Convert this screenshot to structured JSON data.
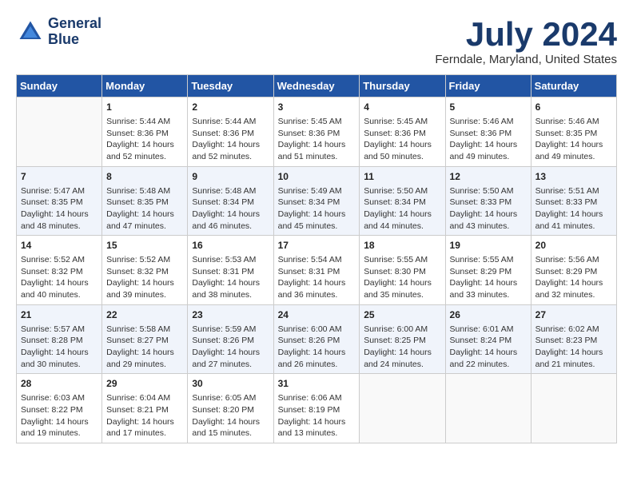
{
  "logo": {
    "line1": "General",
    "line2": "Blue"
  },
  "title": "July 2024",
  "location": "Ferndale, Maryland, United States",
  "days_of_week": [
    "Sunday",
    "Monday",
    "Tuesday",
    "Wednesday",
    "Thursday",
    "Friday",
    "Saturday"
  ],
  "weeks": [
    [
      {
        "day": "",
        "info": ""
      },
      {
        "day": "1",
        "info": "Sunrise: 5:44 AM\nSunset: 8:36 PM\nDaylight: 14 hours\nand 52 minutes."
      },
      {
        "day": "2",
        "info": "Sunrise: 5:44 AM\nSunset: 8:36 PM\nDaylight: 14 hours\nand 52 minutes."
      },
      {
        "day": "3",
        "info": "Sunrise: 5:45 AM\nSunset: 8:36 PM\nDaylight: 14 hours\nand 51 minutes."
      },
      {
        "day": "4",
        "info": "Sunrise: 5:45 AM\nSunset: 8:36 PM\nDaylight: 14 hours\nand 50 minutes."
      },
      {
        "day": "5",
        "info": "Sunrise: 5:46 AM\nSunset: 8:36 PM\nDaylight: 14 hours\nand 49 minutes."
      },
      {
        "day": "6",
        "info": "Sunrise: 5:46 AM\nSunset: 8:35 PM\nDaylight: 14 hours\nand 49 minutes."
      }
    ],
    [
      {
        "day": "7",
        "info": "Sunrise: 5:47 AM\nSunset: 8:35 PM\nDaylight: 14 hours\nand 48 minutes."
      },
      {
        "day": "8",
        "info": "Sunrise: 5:48 AM\nSunset: 8:35 PM\nDaylight: 14 hours\nand 47 minutes."
      },
      {
        "day": "9",
        "info": "Sunrise: 5:48 AM\nSunset: 8:34 PM\nDaylight: 14 hours\nand 46 minutes."
      },
      {
        "day": "10",
        "info": "Sunrise: 5:49 AM\nSunset: 8:34 PM\nDaylight: 14 hours\nand 45 minutes."
      },
      {
        "day": "11",
        "info": "Sunrise: 5:50 AM\nSunset: 8:34 PM\nDaylight: 14 hours\nand 44 minutes."
      },
      {
        "day": "12",
        "info": "Sunrise: 5:50 AM\nSunset: 8:33 PM\nDaylight: 14 hours\nand 43 minutes."
      },
      {
        "day": "13",
        "info": "Sunrise: 5:51 AM\nSunset: 8:33 PM\nDaylight: 14 hours\nand 41 minutes."
      }
    ],
    [
      {
        "day": "14",
        "info": "Sunrise: 5:52 AM\nSunset: 8:32 PM\nDaylight: 14 hours\nand 40 minutes."
      },
      {
        "day": "15",
        "info": "Sunrise: 5:52 AM\nSunset: 8:32 PM\nDaylight: 14 hours\nand 39 minutes."
      },
      {
        "day": "16",
        "info": "Sunrise: 5:53 AM\nSunset: 8:31 PM\nDaylight: 14 hours\nand 38 minutes."
      },
      {
        "day": "17",
        "info": "Sunrise: 5:54 AM\nSunset: 8:31 PM\nDaylight: 14 hours\nand 36 minutes."
      },
      {
        "day": "18",
        "info": "Sunrise: 5:55 AM\nSunset: 8:30 PM\nDaylight: 14 hours\nand 35 minutes."
      },
      {
        "day": "19",
        "info": "Sunrise: 5:55 AM\nSunset: 8:29 PM\nDaylight: 14 hours\nand 33 minutes."
      },
      {
        "day": "20",
        "info": "Sunrise: 5:56 AM\nSunset: 8:29 PM\nDaylight: 14 hours\nand 32 minutes."
      }
    ],
    [
      {
        "day": "21",
        "info": "Sunrise: 5:57 AM\nSunset: 8:28 PM\nDaylight: 14 hours\nand 30 minutes."
      },
      {
        "day": "22",
        "info": "Sunrise: 5:58 AM\nSunset: 8:27 PM\nDaylight: 14 hours\nand 29 minutes."
      },
      {
        "day": "23",
        "info": "Sunrise: 5:59 AM\nSunset: 8:26 PM\nDaylight: 14 hours\nand 27 minutes."
      },
      {
        "day": "24",
        "info": "Sunrise: 6:00 AM\nSunset: 8:26 PM\nDaylight: 14 hours\nand 26 minutes."
      },
      {
        "day": "25",
        "info": "Sunrise: 6:00 AM\nSunset: 8:25 PM\nDaylight: 14 hours\nand 24 minutes."
      },
      {
        "day": "26",
        "info": "Sunrise: 6:01 AM\nSunset: 8:24 PM\nDaylight: 14 hours\nand 22 minutes."
      },
      {
        "day": "27",
        "info": "Sunrise: 6:02 AM\nSunset: 8:23 PM\nDaylight: 14 hours\nand 21 minutes."
      }
    ],
    [
      {
        "day": "28",
        "info": "Sunrise: 6:03 AM\nSunset: 8:22 PM\nDaylight: 14 hours\nand 19 minutes."
      },
      {
        "day": "29",
        "info": "Sunrise: 6:04 AM\nSunset: 8:21 PM\nDaylight: 14 hours\nand 17 minutes."
      },
      {
        "day": "30",
        "info": "Sunrise: 6:05 AM\nSunset: 8:20 PM\nDaylight: 14 hours\nand 15 minutes."
      },
      {
        "day": "31",
        "info": "Sunrise: 6:06 AM\nSunset: 8:19 PM\nDaylight: 14 hours\nand 13 minutes."
      },
      {
        "day": "",
        "info": ""
      },
      {
        "day": "",
        "info": ""
      },
      {
        "day": "",
        "info": ""
      }
    ]
  ]
}
